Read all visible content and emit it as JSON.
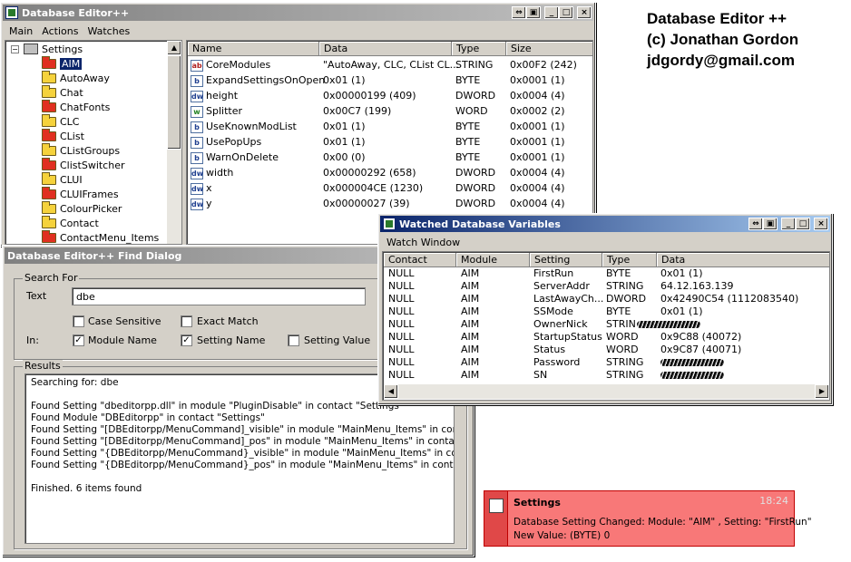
{
  "main_window": {
    "title": "Database Editor++",
    "buttons": [
      "⇔",
      "▣",
      "_",
      "□",
      "×"
    ],
    "menu": [
      "Main",
      "Actions",
      "Watches"
    ],
    "tree": {
      "expander": "−",
      "root": "Settings",
      "items": [
        {
          "label": "AIM",
          "color": "red",
          "selected": true
        },
        {
          "label": "AutoAway",
          "color": "yellow"
        },
        {
          "label": "Chat",
          "color": "yellow"
        },
        {
          "label": "ChatFonts",
          "color": "red"
        },
        {
          "label": "CLC",
          "color": "yellow"
        },
        {
          "label": "CList",
          "color": "red"
        },
        {
          "label": "CListGroups",
          "color": "yellow"
        },
        {
          "label": "ClistSwitcher",
          "color": "red"
        },
        {
          "label": "CLUI",
          "color": "yellow"
        },
        {
          "label": "CLUIFrames",
          "color": "red"
        },
        {
          "label": "ColourPicker",
          "color": "yellow"
        },
        {
          "label": "Contact",
          "color": "yellow"
        },
        {
          "label": "ContactMenu_Items",
          "color": "red"
        }
      ]
    },
    "list": {
      "columns": [
        "Name",
        "Data",
        "Type",
        "Size"
      ],
      "rows": [
        {
          "icon": "ab",
          "name": "CoreModules",
          "data": "\"AutoAway, CLC, CList CL...",
          "type": "STRING",
          "size": "0x00F2 (242)"
        },
        {
          "icon": "b",
          "name": "ExpandSettingsOnOpen",
          "data": "0x01 (1)",
          "type": "BYTE",
          "size": "0x0001 (1)"
        },
        {
          "icon": "dw",
          "name": "height",
          "data": "0x00000199 (409)",
          "type": "DWORD",
          "size": "0x0004 (4)"
        },
        {
          "icon": "w",
          "name": "Splitter",
          "data": "0x00C7 (199)",
          "type": "WORD",
          "size": "0x0002 (2)"
        },
        {
          "icon": "b",
          "name": "UseKnownModList",
          "data": "0x01 (1)",
          "type": "BYTE",
          "size": "0x0001 (1)"
        },
        {
          "icon": "b",
          "name": "UsePopUps",
          "data": "0x01 (1)",
          "type": "BYTE",
          "size": "0x0001 (1)"
        },
        {
          "icon": "b",
          "name": "WarnOnDelete",
          "data": "0x00 (0)",
          "type": "BYTE",
          "size": "0x0001 (1)"
        },
        {
          "icon": "dw",
          "name": "width",
          "data": "0x00000292 (658)",
          "type": "DWORD",
          "size": "0x0004 (4)"
        },
        {
          "icon": "dw",
          "name": "x",
          "data": "0x000004CE (1230)",
          "type": "DWORD",
          "size": "0x0004 (4)"
        },
        {
          "icon": "dw",
          "name": "y",
          "data": "0x00000027 (39)",
          "type": "DWORD",
          "size": "0x0004 (4)"
        }
      ]
    }
  },
  "find_dialog": {
    "title": "Database Editor++ Find Dialog",
    "search_for_label": "Search For",
    "text_label": "Text",
    "text_value": "dbe",
    "in_label": "In:",
    "options": {
      "case_sensitive": {
        "label": "Case Sensitive",
        "checked": false
      },
      "exact_match": {
        "label": "Exact Match",
        "checked": false
      },
      "module_name": {
        "label": "Module Name",
        "checked": true
      },
      "setting_name": {
        "label": "Setting Name",
        "checked": true
      },
      "setting_value": {
        "label": "Setting Value",
        "checked": false
      }
    },
    "results_label": "Results",
    "results": [
      "Searching for: dbe",
      "",
      "Found Setting \"dbeditorpp.dll\" in module \"PluginDisable\" in contact \"Settings\"",
      "Found Module \"DBEditorpp\" in contact \"Settings\"",
      "Found Setting \"[DBEditorpp/MenuCommand]_visible\" in module \"MainMenu_Items\" in contact \"Se",
      "Found Setting \"[DBEditorpp/MenuCommand]_pos\" in module \"MainMenu_Items\" in contact \"Settin",
      "Found Setting \"{DBEditorpp/MenuCommand}_visible\" in module \"MainMenu_Items\" in contact \"Se",
      "Found Setting \"{DBEditorpp/MenuCommand}_pos\" in module \"MainMenu_Items\" in contact \"Setti",
      "",
      "Finished. 6 items found"
    ]
  },
  "watch_window": {
    "title": "Watched Database Variables",
    "buttons": [
      "⇔",
      "▣",
      "_",
      "□",
      "×"
    ],
    "menu": "Watch Window",
    "columns": [
      "Contact",
      "Module",
      "Setting",
      "Type",
      "Data"
    ],
    "rows": [
      {
        "contact": "NULL",
        "module": "AIM",
        "setting": "FirstRun",
        "type": "BYTE",
        "data": "0x01 (1)"
      },
      {
        "contact": "NULL",
        "module": "AIM",
        "setting": "ServerAddr",
        "type": "STRING",
        "data": "64.12.163.139"
      },
      {
        "contact": "NULL",
        "module": "AIM",
        "setting": "LastAwayCh...",
        "type": "DWORD",
        "data": "0x42490C54 (1112083540)"
      },
      {
        "contact": "NULL",
        "module": "AIM",
        "setting": "SSMode",
        "type": "BYTE",
        "data": "0x01 (1)"
      },
      {
        "contact": "NULL",
        "module": "AIM",
        "setting": "OwnerNick",
        "type": "STRIN",
        "data": "",
        "redacted": true
      },
      {
        "contact": "NULL",
        "module": "AIM",
        "setting": "StartupStatus",
        "type": "WORD",
        "data": "0x9C88 (40072)"
      },
      {
        "contact": "NULL",
        "module": "AIM",
        "setting": "Status",
        "type": "WORD",
        "data": "0x9C87 (40071)"
      },
      {
        "contact": "NULL",
        "module": "AIM",
        "setting": "Password",
        "type": "STRING",
        "data": "",
        "redacted": true
      },
      {
        "contact": "NULL",
        "module": "AIM",
        "setting": "SN",
        "type": "STRING",
        "data": "",
        "redacted": true
      }
    ]
  },
  "credits": {
    "line1": "Database Editor ++",
    "line2": "(c) Jonathan Gordon",
    "line3": "jdgordy@gmail.com"
  },
  "popup": {
    "title": "Settings",
    "time": "18:24",
    "line1": "Database Setting Changed: Module: \"AIM\" , Setting: \"FirstRun\"",
    "line2": "New Value: (BYTE) 0"
  },
  "colors": {
    "title_active": "#0a246a",
    "popup_bg": "#f87878",
    "folder_red": "#e03020",
    "folder_yellow": "#f5d23c"
  }
}
